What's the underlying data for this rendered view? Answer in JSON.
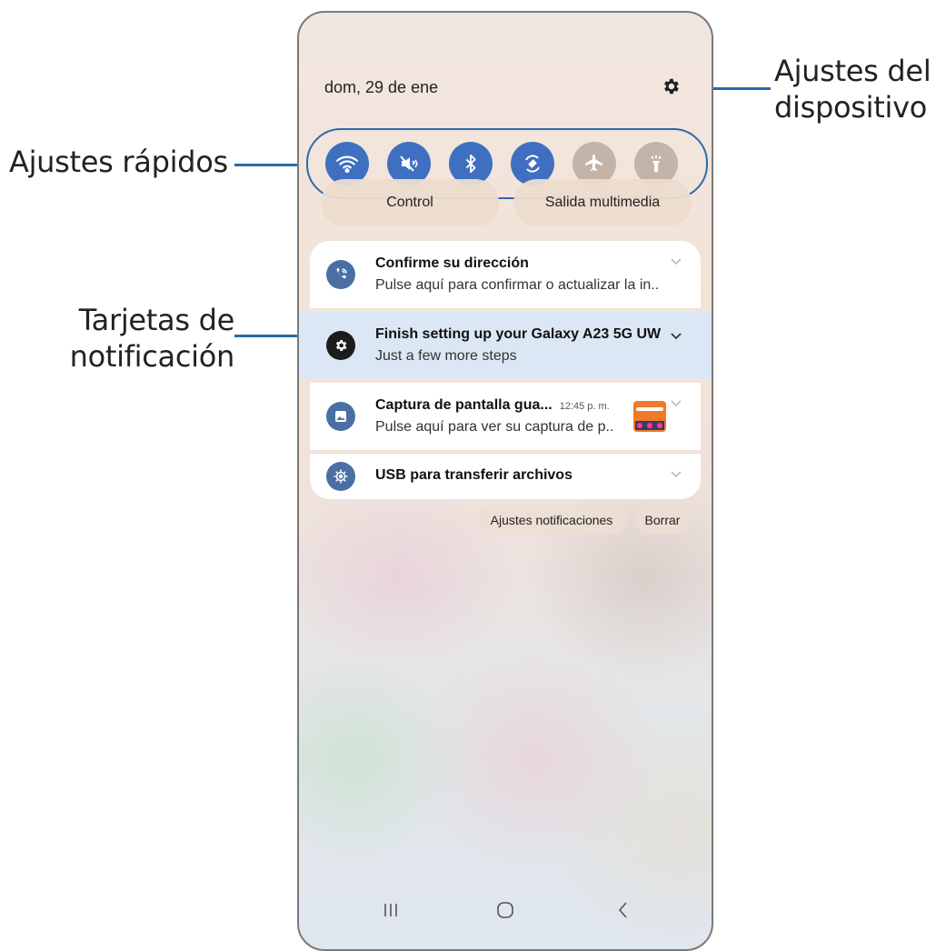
{
  "callouts": {
    "device_settings": "Ajustes del\ndispositivo",
    "device_settings_line1": "Ajustes del",
    "device_settings_line2": "dispositivo",
    "quick_settings": "Ajustes rápidos",
    "notification_cards_line1": "Tarjetas de",
    "notification_cards_line2": "notificación"
  },
  "panel": {
    "date": "dom, 29 de ene",
    "settings_icon": "gear-icon"
  },
  "quick_settings": [
    {
      "icon": "wifi-icon",
      "state": "on"
    },
    {
      "icon": "mute-icon",
      "state": "on"
    },
    {
      "icon": "bluetooth-icon",
      "state": "on"
    },
    {
      "icon": "auto-rotate-icon",
      "state": "on"
    },
    {
      "icon": "airplane-icon",
      "state": "off"
    },
    {
      "icon": "flashlight-icon",
      "state": "off"
    }
  ],
  "pills": {
    "control": "Control",
    "media_output": "Salida multimedia"
  },
  "notifications": [
    {
      "title": "Confirme su dirección",
      "body": "Pulse aquí para confirmar o actualizar la in..",
      "icon": "wifi-call-icon"
    },
    {
      "title": "Finish setting up your Galaxy A23 5G UW",
      "body": "Just a few more steps",
      "icon": "settings-gear-icon"
    },
    {
      "title": "Captura de pantalla gua...",
      "time": "12:45 p. m.",
      "body": "Pulse aquí para ver su captura de p..",
      "icon": "gallery-icon"
    },
    {
      "title": "USB para transferir archivos",
      "icon": "usb-settings-icon"
    }
  ],
  "actions": {
    "notification_settings": "Ajustes notificaciones",
    "clear": "Borrar"
  },
  "colors": {
    "accent": "#3f6fc0",
    "callout_line": "#2d6aa8",
    "inactive_toggle": "#c4b4a8",
    "highlight_card": "#dbe7f4"
  }
}
